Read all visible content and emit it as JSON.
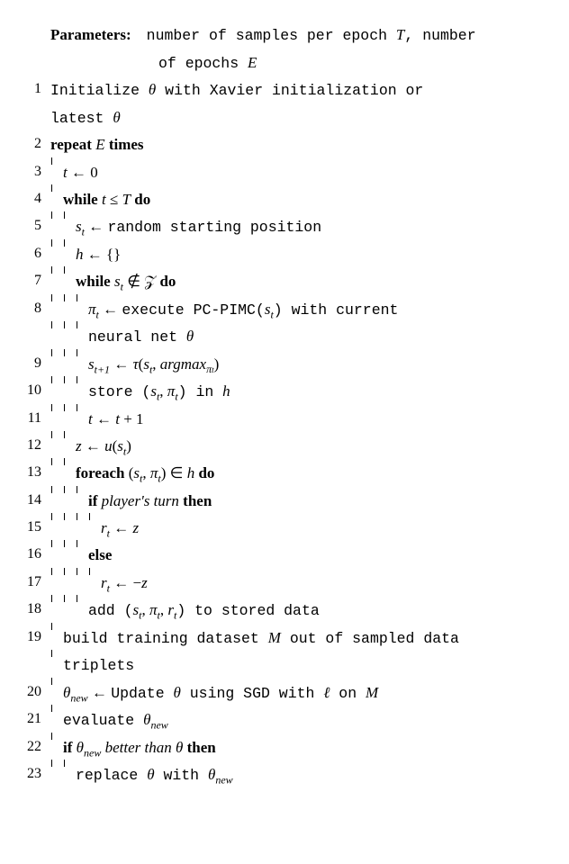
{
  "header": {
    "params_label": "Parameters:",
    "params_text1_a": "number of samples per epoch ",
    "params_text1_T": "T",
    "params_text1_b": ", number",
    "params_text2_a": "of epochs ",
    "params_text2_E": "E"
  },
  "lines": {
    "l1": {
      "no": "1",
      "a": "Initialize ",
      "b": " with Xavier initialization or"
    },
    "l1b": {
      "a": "latest "
    },
    "l2": {
      "no": "2",
      "a": "repeat ",
      "b": " times"
    },
    "l3": {
      "no": "3",
      "a": " ← 0"
    },
    "l4": {
      "no": "4",
      "a": "while ",
      "b": " ≤ ",
      "c": " do"
    },
    "l5": {
      "no": "5",
      "a": " ← ",
      "b": "random starting position"
    },
    "l6": {
      "no": "6",
      "a": " ← {}"
    },
    "l7": {
      "no": "7",
      "a": "while ",
      "b": " ∉ ",
      "c": " do"
    },
    "l8": {
      "no": "8",
      "a": " ← ",
      "b": "execute PC-PIMC(",
      "c": ") with current"
    },
    "l8b": {
      "a": "neural net "
    },
    "l9": {
      "no": "9",
      "a": " ← ",
      "b": "(",
      "c": ", ",
      "d": ")"
    },
    "l10": {
      "no": "10",
      "a": "store (",
      "b": ", ",
      "c": ") in "
    },
    "l11": {
      "no": "11",
      "a": " ← ",
      "b": " + 1"
    },
    "l12": {
      "no": "12",
      "a": " ← ",
      "b": "(",
      "c": ")"
    },
    "l13": {
      "no": "13",
      "a": "foreach ",
      "b": "(",
      "c": ", ",
      "d": ") ∈ ",
      "e": " do"
    },
    "l14": {
      "no": "14",
      "a": "if ",
      "b": "player's turn",
      "c": " then"
    },
    "l15": {
      "no": "15",
      "a": " ← "
    },
    "l16": {
      "no": "16",
      "a": "else"
    },
    "l17": {
      "no": "17",
      "a": " ← −"
    },
    "l18": {
      "no": "18",
      "a": "add (",
      "b": ", ",
      "c": ", ",
      "d": ") to stored data"
    },
    "l19": {
      "no": "19",
      "a": "build training dataset ",
      "b": " out of sampled data"
    },
    "l19b": {
      "a": "triplets"
    },
    "l20": {
      "no": "20",
      "a": " ← ",
      "b": "Update ",
      "c": " using SGD with ",
      "d": " on "
    },
    "l21": {
      "no": "21",
      "a": "evaluate "
    },
    "l22": {
      "no": "22",
      "a": "if ",
      "b": " better than ",
      "c": " then"
    },
    "l23": {
      "no": "23",
      "a": "replace ",
      "b": " with "
    }
  },
  "sym": {
    "theta": "θ",
    "theta_new": "θ",
    "new": "new",
    "t": "t",
    "T": "T",
    "E": "E",
    "s": "s",
    "h": "h",
    "Z": "𝒵",
    "pi": "π",
    "tau": "τ",
    "argmax": "argmax",
    "u": "u",
    "z": "z",
    "r": "r",
    "M": "M",
    "ell": "ℓ",
    "tp1": "t+1"
  }
}
